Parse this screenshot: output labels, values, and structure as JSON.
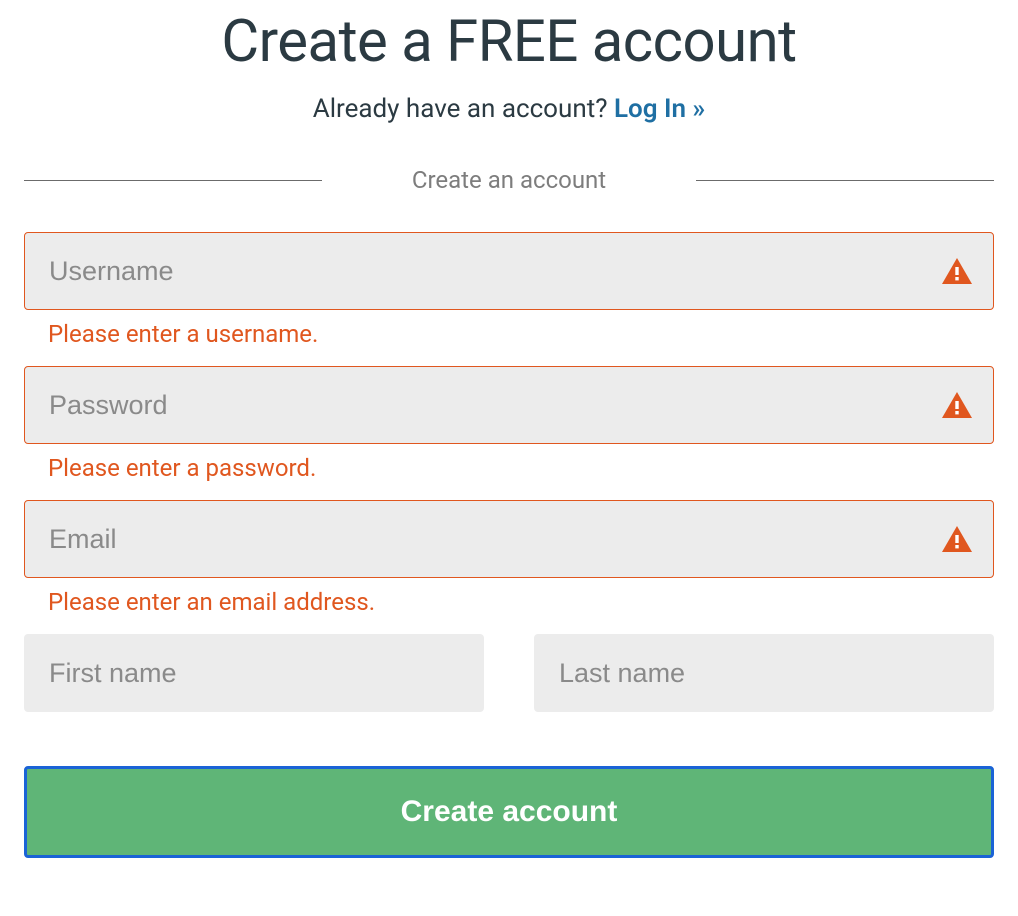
{
  "header": {
    "title": "Create a FREE account",
    "subtitle_prefix": "Already have an account? ",
    "login_link": "Log In »"
  },
  "divider": {
    "label": "Create an account"
  },
  "fields": {
    "username": {
      "placeholder": "Username",
      "error": "Please enter a username."
    },
    "password": {
      "placeholder": "Password",
      "error": "Please enter a password."
    },
    "email": {
      "placeholder": "Email",
      "error": "Please enter an email address."
    },
    "first_name": {
      "placeholder": "First name"
    },
    "last_name": {
      "placeholder": "Last name"
    }
  },
  "submit": {
    "label": "Create account"
  },
  "colors": {
    "error": "#e0571f",
    "accent_link": "#1f6fa3",
    "button_bg": "#5fb577",
    "button_border": "#1a63d6"
  }
}
